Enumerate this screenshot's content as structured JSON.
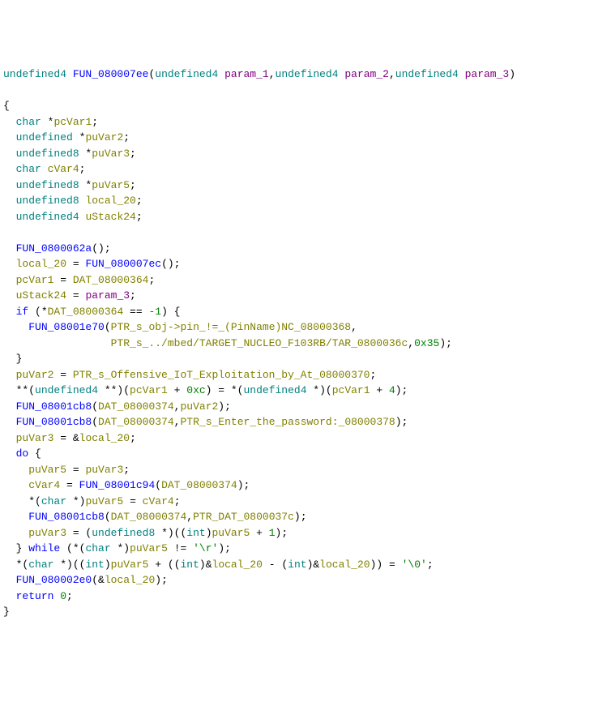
{
  "code": {
    "line_1": {
      "type1": "undefined4",
      "func": "FUN_080007ee",
      "lparen": "(",
      "type2": "undefined4",
      "param1": "param_1",
      "comma1": ",",
      "type3": "undefined4",
      "param2": "param_2",
      "comma2": ",",
      "type4": "undefined4",
      "param3": "param_3",
      "rparen": ")"
    },
    "line_3": "{",
    "decl_1": {
      "type": "char",
      "star": " *",
      "ident": "pcVar1",
      "semi": ";"
    },
    "decl_2": {
      "type": "undefined",
      "star": " *",
      "ident": "puVar2",
      "semi": ";"
    },
    "decl_3": {
      "type": "undefined8",
      "star": " *",
      "ident": "puVar3",
      "semi": ";"
    },
    "decl_4": {
      "type": "char",
      "star": " ",
      "ident": "cVar4",
      "semi": ";"
    },
    "decl_5": {
      "type": "undefined8",
      "star": " *",
      "ident": "puVar5",
      "semi": ";"
    },
    "decl_6": {
      "type": "undefined8",
      "star": " ",
      "ident": "local_20",
      "semi": ";"
    },
    "decl_7": {
      "type": "undefined4",
      "star": " ",
      "ident": "uStack24",
      "semi": ";"
    },
    "call_1": {
      "func": "FUN_0800062a",
      "args": "();"
    },
    "assign_1": {
      "lhs": "local_20",
      "eq": " = ",
      "func": "FUN_080007ec",
      "args": "();"
    },
    "assign_2": {
      "lhs": "pcVar1",
      "eq": " = ",
      "rhs": "DAT_08000364",
      "semi": ";"
    },
    "assign_3": {
      "lhs": "uStack24",
      "eq": " = ",
      "rhs": "param_3",
      "semi": ";"
    },
    "if_1": {
      "if": "if",
      "lparen": " (*",
      "cond": "DAT_08000364",
      "op": " == ",
      "neg": "-1",
      "rparen": ") {"
    },
    "call_2": {
      "func": "FUN_08001e70",
      "lparen": "(",
      "arg1": "PTR_s_obj->pin_!=_(PinName)NC_08000368",
      "comma": ","
    },
    "call_2b": {
      "arg2": "PTR_s_../mbed/TARGET_NUCLEO_F103RB/TAR_0800036c",
      "comma": ",",
      "num": "0x35",
      "rparen": ");"
    },
    "close_1": "}",
    "assign_4": {
      "lhs": "puVar2",
      "eq": " = ",
      "rhs": "PTR_s_Offensive_IoT_Exploitation_by_At_08000370",
      "semi": ";"
    },
    "assign_5": {
      "prefix": "**(",
      "type1": "undefined4",
      "mid1": " **)(",
      "ident1": "pcVar1",
      "plus1": " + ",
      "num1": "0xc",
      "mid2": ") = *(",
      "type2": "undefined4",
      "mid3": " *)(",
      "ident2": "pcVar1",
      "plus2": " + ",
      "num2": "4",
      "end": ");"
    },
    "call_3": {
      "func": "FUN_08001cb8",
      "lparen": "(",
      "arg1": "DAT_08000374",
      "comma": ",",
      "arg2": "puVar2",
      "rparen": ");"
    },
    "call_4": {
      "func": "FUN_08001cb8",
      "lparen": "(",
      "arg1": "DAT_08000374",
      "comma": ",",
      "arg2": "PTR_s_Enter_the_password:_08000378",
      "rparen": ");"
    },
    "assign_6": {
      "lhs": "puVar3",
      "eq": " = &",
      "rhs": "local_20",
      "semi": ";"
    },
    "do_1": "do",
    "do_brace": " {",
    "assign_7": {
      "lhs": "puVar5",
      "eq": " = ",
      "rhs": "puVar3",
      "semi": ";"
    },
    "assign_8": {
      "lhs": "cVar4",
      "eq": " = ",
      "func": "FUN_08001c94",
      "lparen": "(",
      "arg": "DAT_08000374",
      "rparen": ");"
    },
    "assign_9": {
      "prefix": "*(",
      "type": "char",
      "mid": " *)",
      "lhs": "puVar5",
      "eq": " = ",
      "rhs": "cVar4",
      "semi": ";"
    },
    "call_5": {
      "func": "FUN_08001cb8",
      "lparen": "(",
      "arg1": "DAT_08000374",
      "comma": ",",
      "arg2": "PTR_DAT_0800037c",
      "rparen": ");"
    },
    "assign_10": {
      "lhs": "puVar3",
      "eq": " = (",
      "type": "undefined8",
      "mid": " *)((",
      "int": "int",
      "rparen1": ")",
      "ident": "puVar5",
      "plus": " + ",
      "num": "1",
      "end": ");"
    },
    "while_1": {
      "close": "} ",
      "while": "while",
      "lparen": " (*(",
      "type": "char",
      "mid": " *)",
      "ident": "puVar5",
      "op": " != ",
      "str": "'\\r'",
      "rparen": ");"
    },
    "assign_11": {
      "prefix": "*(",
      "type": "char",
      "mid1": " *)((",
      "int1": "int",
      "rparen1": ")",
      "ident1": "puVar5",
      "plus1": " + ((",
      "int2": "int",
      "rparen2": ")&",
      "ident2": "local_20",
      "minus": " - (",
      "int3": "int",
      "rparen3": ")&",
      "ident3": "local_20",
      "mid2": ")) = ",
      "str": "'\\0'",
      "semi": ";"
    },
    "call_6": {
      "func": "FUN_080002e0",
      "lparen": "(&",
      "arg": "local_20",
      "rparen": ");"
    },
    "return_1": {
      "ret": "return",
      "sp": " ",
      "num": "0",
      "semi": ";"
    },
    "close_2": "}"
  }
}
